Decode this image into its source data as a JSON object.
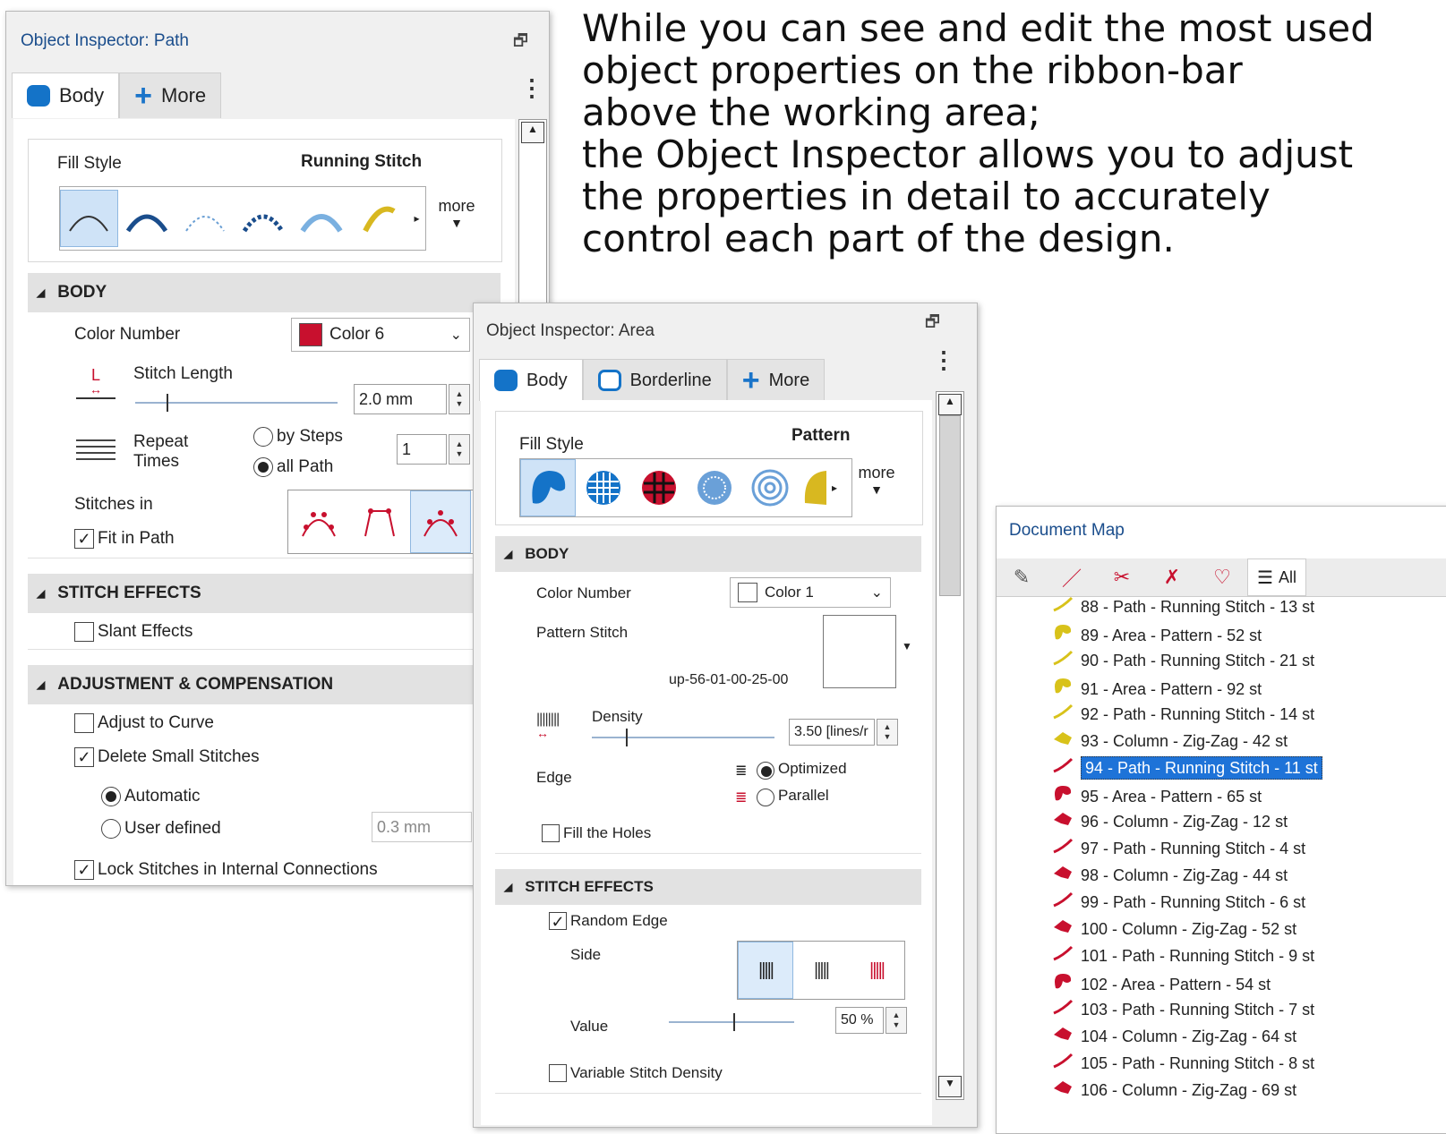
{
  "description": {
    "lines": [
      "While you can see and edit the most used",
      "object properties on the ribbon-bar",
      "above the working area;",
      "the Object Inspector allows you to adjust",
      "the properties in detail to accurately",
      "control each part of the design."
    ]
  },
  "path_inspector": {
    "title": "Object Inspector: Path",
    "tabs": [
      "Body",
      "More"
    ],
    "fill_style_label": "Fill Style",
    "fill_style_value": "Running Stitch",
    "more_label": "more",
    "body_section": "BODY",
    "color_number_label": "Color Number",
    "color_value": "Color 6",
    "color_hex": "#c8102e",
    "stitch_length_label": "Stitch Length",
    "stitch_length_value": "2.0 mm",
    "repeat_label_1": "Repeat",
    "repeat_label_2": "Times",
    "by_steps_label": "by Steps",
    "all_path_label": "all Path",
    "repeat_value": "1",
    "stitches_in_label": "Stitches in",
    "fit_in_path_label": "Fit in Path",
    "stitch_effects_section": "STITCH EFFECTS",
    "slant_effects_label": "Slant Effects",
    "adjustment_section": "ADJUSTMENT & COMPENSATION",
    "adjust_to_curve_label": "Adjust to Curve",
    "delete_small_label": "Delete Small Stitches",
    "automatic_label": "Automatic",
    "user_defined_label": "User defined",
    "user_defined_value": "0.3 mm",
    "lock_stitches_label": "Lock Stitches in Internal Connections"
  },
  "area_inspector": {
    "title": "Object Inspector: Area",
    "tabs": [
      "Body",
      "Borderline",
      "More"
    ],
    "fill_style_label": "Fill Style",
    "fill_style_value": "Pattern",
    "more_label": "more",
    "body_section": "BODY",
    "color_number_label": "Color Number",
    "color_value": "Color 1",
    "pattern_stitch_label": "Pattern Stitch",
    "pattern_code": "up-56-01-00-25-00",
    "density_label": "Density",
    "density_value": "3.50 [lines/r",
    "edge_label": "Edge",
    "optimized_label": "Optimized",
    "parallel_label": "Parallel",
    "fill_holes_label": "Fill the Holes",
    "stitch_effects_section": "STITCH EFFECTS",
    "random_edge_label": "Random Edge",
    "side_label": "Side",
    "value_label": "Value",
    "value_value": "50 %",
    "variable_density_label": "Variable Stitch Density"
  },
  "document_map": {
    "title": "Document Map",
    "all_label": "All",
    "items": [
      {
        "text": "88 - Path - Running Stitch - 13 st",
        "kind": "path",
        "color": "#d8c21a"
      },
      {
        "text": "89 - Area - Pattern - 52 st",
        "kind": "area",
        "color": "#d8c21a"
      },
      {
        "text": "90 - Path - Running Stitch - 21 st",
        "kind": "path",
        "color": "#d8c21a"
      },
      {
        "text": "91 - Area - Pattern - 92 st",
        "kind": "area",
        "color": "#d8c21a"
      },
      {
        "text": "92 - Path - Running Stitch - 14 st",
        "kind": "path",
        "color": "#d8c21a"
      },
      {
        "text": "93 - Column - Zig-Zag - 42 st",
        "kind": "column",
        "color": "#d8c21a"
      },
      {
        "text": "94 - Path - Running Stitch - 11 st",
        "kind": "path",
        "color": "#c8102e",
        "selected": true
      },
      {
        "text": "95 - Area - Pattern - 65 st",
        "kind": "area",
        "color": "#c8102e"
      },
      {
        "text": "96 - Column - Zig-Zag - 12 st",
        "kind": "column",
        "color": "#c8102e"
      },
      {
        "text": "97 - Path - Running Stitch - 4 st",
        "kind": "path",
        "color": "#c8102e"
      },
      {
        "text": "98 - Column - Zig-Zag - 44 st",
        "kind": "column",
        "color": "#c8102e"
      },
      {
        "text": "99 - Path - Running Stitch - 6 st",
        "kind": "path",
        "color": "#c8102e"
      },
      {
        "text": "100 - Column - Zig-Zag - 52 st",
        "kind": "column",
        "color": "#c8102e"
      },
      {
        "text": "101 - Path - Running Stitch - 9 st",
        "kind": "path",
        "color": "#c8102e"
      },
      {
        "text": "102 - Area - Pattern - 54 st",
        "kind": "area",
        "color": "#c8102e"
      },
      {
        "text": "103 - Path - Running Stitch - 7 st",
        "kind": "path",
        "color": "#c8102e"
      },
      {
        "text": "104 - Column - Zig-Zag - 64 st",
        "kind": "column",
        "color": "#c8102e"
      },
      {
        "text": "105 - Path - Running Stitch - 8 st",
        "kind": "path",
        "color": "#c8102e"
      },
      {
        "text": "106 - Column - Zig-Zag - 69 st",
        "kind": "column",
        "color": "#c8102e"
      }
    ]
  },
  "colors": {
    "accent": "#1473c8",
    "selection": "#1e73d8",
    "red": "#c8102e"
  }
}
